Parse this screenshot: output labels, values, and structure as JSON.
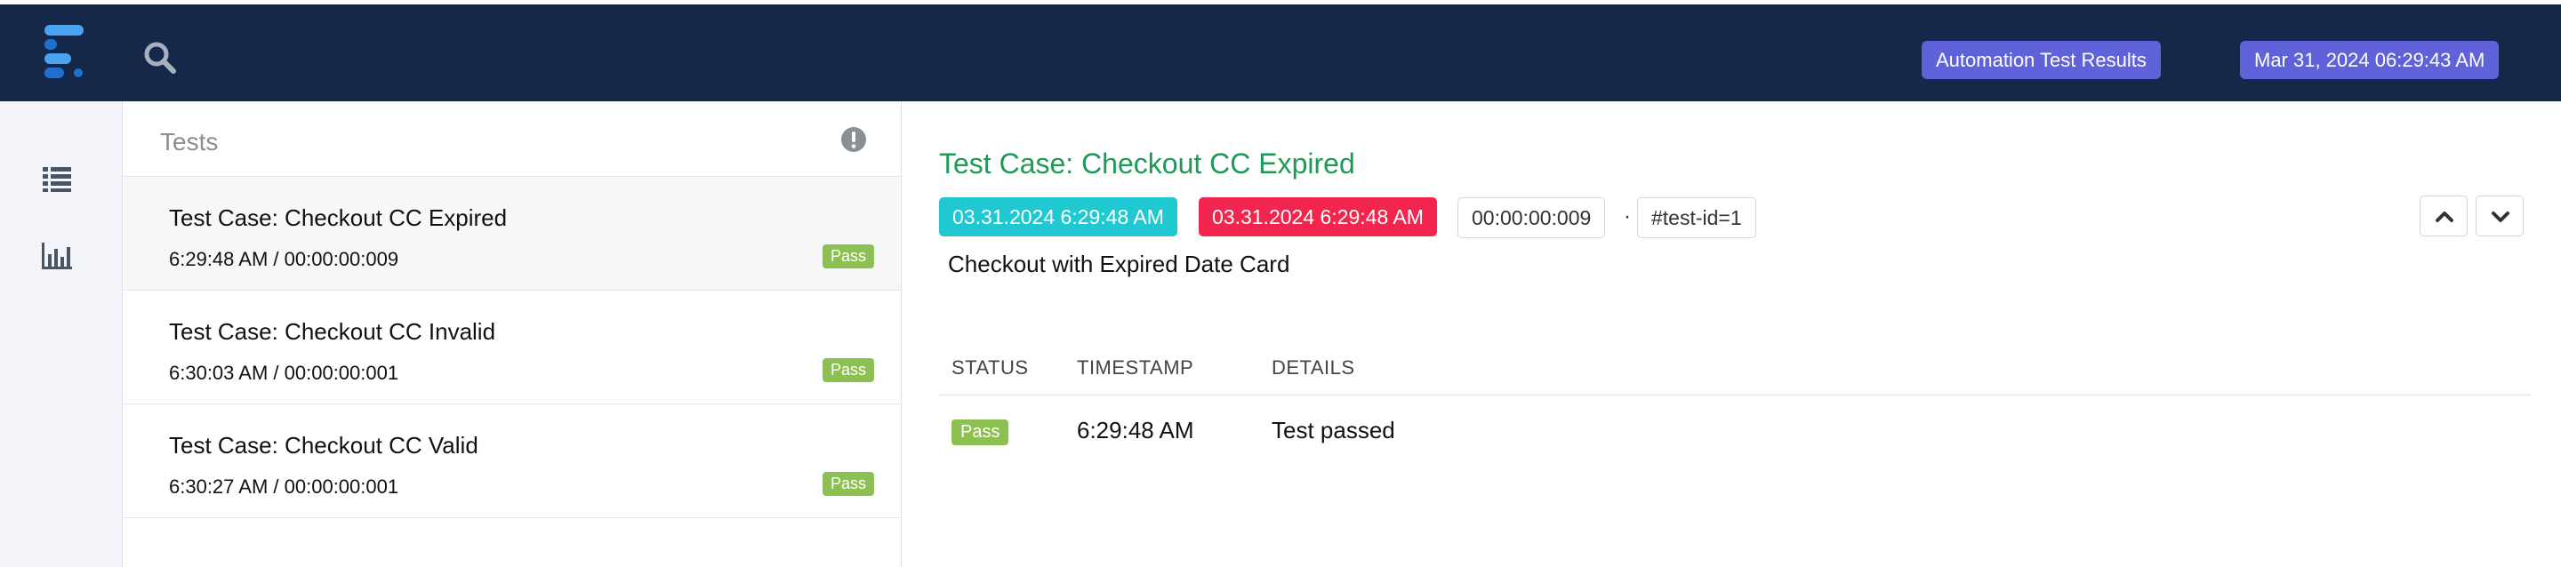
{
  "colors": {
    "topbar_bg": "#16284a",
    "badge_bg": "#5f62d9",
    "accent_green": "#1f9a56",
    "start_tag": "#20c8d2",
    "end_tag": "#f2254f",
    "pass": "#8cc152",
    "logo_light": "#4aa3f0",
    "logo_dark": "#1e6fd0",
    "sidebar_icon": "#4a5566"
  },
  "header": {
    "report_badge": "Automation Test Results",
    "date_badge": "Mar 31, 2024 06:29:43 AM",
    "logo_icon": "extent-logo-icon",
    "search_icon": "search-icon"
  },
  "sidebar": {
    "items": [
      {
        "icon": "list-icon"
      },
      {
        "icon": "bar-chart-icon"
      }
    ]
  },
  "tests_panel": {
    "title": "Tests",
    "status_icon": "exclamation-circle-icon",
    "tests": [
      {
        "name": "Test Case: Checkout CC Expired",
        "meta": "6:29:48 AM / 00:00:00:009",
        "status": "Pass"
      },
      {
        "name": "Test Case: Checkout CC Invalid",
        "meta": "6:30:03 AM / 00:00:00:001",
        "status": "Pass"
      },
      {
        "name": "Test Case: Checkout CC Valid",
        "meta": "6:30:27 AM / 00:00:00:001",
        "status": "Pass"
      }
    ]
  },
  "detail": {
    "title": "Test Case: Checkout CC Expired",
    "start_time": "03.31.2024 6:29:48 AM",
    "end_time": "03.31.2024 6:29:48 AM",
    "duration": "00:00:00:009",
    "separator": "·",
    "test_id": "#test-id=1",
    "description": "Checkout with Expired Date Card",
    "prev_icon": "chevron-up-icon",
    "next_icon": "chevron-down-icon",
    "log": {
      "columns": [
        "STATUS",
        "TIMESTAMP",
        "DETAILS"
      ],
      "rows": [
        {
          "status": "Pass",
          "timestamp": "6:29:48 AM",
          "details": "Test passed"
        }
      ]
    }
  }
}
